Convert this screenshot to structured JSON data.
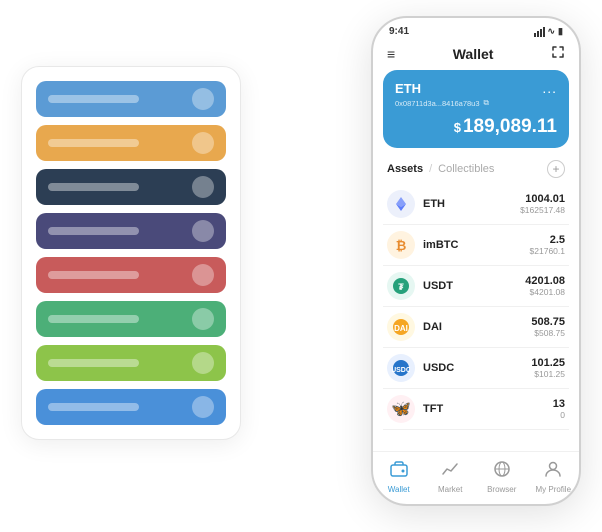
{
  "scene": {
    "card_stack": {
      "items": [
        {
          "color": "card-blue"
        },
        {
          "color": "card-orange"
        },
        {
          "color": "card-dark"
        },
        {
          "color": "card-purple"
        },
        {
          "color": "card-red"
        },
        {
          "color": "card-green"
        },
        {
          "color": "card-lime"
        },
        {
          "color": "card-lightblue"
        }
      ]
    },
    "phone": {
      "status_bar": {
        "time": "9:41"
      },
      "header": {
        "menu_icon": "≡",
        "title": "Wallet",
        "expand_icon": "⇱"
      },
      "eth_card": {
        "token": "ETH",
        "address": "0x08711d3a...8416a78u3",
        "copy_icon": "⧉",
        "dots": "...",
        "balance_prefix": "$",
        "balance": "189,089.11"
      },
      "assets_section": {
        "tab_active": "Assets",
        "tab_divider": "/",
        "tab_inactive": "Collectibles",
        "add_icon": "+"
      },
      "assets": [
        {
          "symbol": "ETH",
          "icon_char": "◈",
          "icon_class": "eth",
          "amount": "1004.01",
          "usd": "$162517.48"
        },
        {
          "symbol": "imBTC",
          "icon_char": "⊙",
          "icon_class": "imbtc",
          "amount": "2.5",
          "usd": "$21760.1"
        },
        {
          "symbol": "USDT",
          "icon_char": "₮",
          "icon_class": "usdt",
          "amount": "4201.08",
          "usd": "$4201.08"
        },
        {
          "symbol": "DAI",
          "icon_char": "◉",
          "icon_class": "dai",
          "amount": "508.75",
          "usd": "$508.75"
        },
        {
          "symbol": "USDC",
          "icon_char": "©",
          "icon_class": "usdc",
          "amount": "101.25",
          "usd": "$101.25"
        },
        {
          "symbol": "TFT",
          "icon_char": "✦",
          "icon_class": "tft",
          "amount": "13",
          "usd": "0"
        }
      ],
      "bottom_nav": [
        {
          "label": "Wallet",
          "icon": "◎",
          "active": true
        },
        {
          "label": "Market",
          "icon": "📈",
          "active": false
        },
        {
          "label": "Browser",
          "icon": "👤",
          "active": false
        },
        {
          "label": "My Profile",
          "icon": "👤",
          "active": false
        }
      ]
    }
  }
}
